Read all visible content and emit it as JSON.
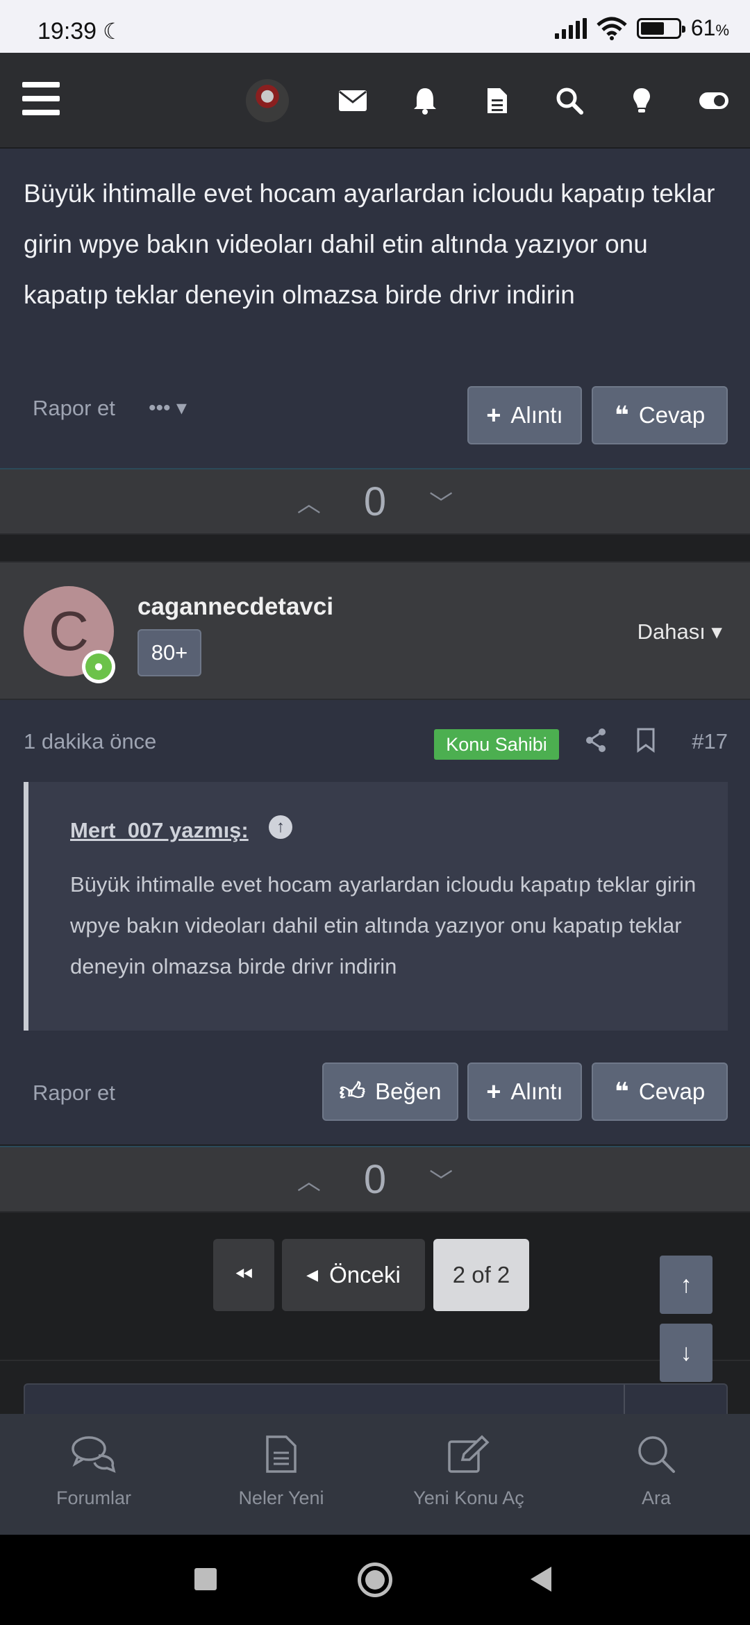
{
  "status_bar": {
    "time": "19:39",
    "battery_pct": "61",
    "battery_unit": "%"
  },
  "post_prev": {
    "body": "Büyük ihtimalle evet hocam ayarlardan icloudu kapatıp teklar girin wpye bakın videoları dahil etin altında yazıyor onu kapatıp teklar deneyin olmazsa birde drivr indirin",
    "report_label": "Rapor et",
    "quote_label": "Alıntı",
    "reply_label": "Cevap",
    "vote_count": "0"
  },
  "post": {
    "username": "cagannecdetavci",
    "avatar_letter": "C",
    "user_badge": "80+",
    "more_label": "Dahası",
    "time": "1 dakika önce",
    "owner_badge": "Konu Sahibi",
    "post_number": "#17",
    "quote": {
      "author": "Mert_007 yazmış:",
      "text": "Büyük ihtimalle evet hocam ayarlardan icloudu kapatıp teklar girin wpye bakın videoları dahil etin altında yazıyor onu kapatıp teklar deneyin olmazsa birde drivr indirin"
    },
    "report_label": "Rapor et",
    "like_label": "Beğen",
    "quote_label": "Alıntı",
    "reply_label": "Cevap",
    "vote_count": "0"
  },
  "pagination": {
    "prev_label": "Önceki",
    "current": "2 of 2"
  },
  "bottom_nav": {
    "items": [
      {
        "label": "Forumlar",
        "icon": "comments-icon"
      },
      {
        "label": "Neler Yeni",
        "icon": "file-icon"
      },
      {
        "label": "Yeni Konu Aç",
        "icon": "edit-icon"
      },
      {
        "label": "Ara",
        "icon": "search-icon"
      }
    ]
  },
  "colors": {
    "accent_button": "#5c6577",
    "owner_badge": "#4caf50",
    "post_bg": "#2e3240"
  }
}
